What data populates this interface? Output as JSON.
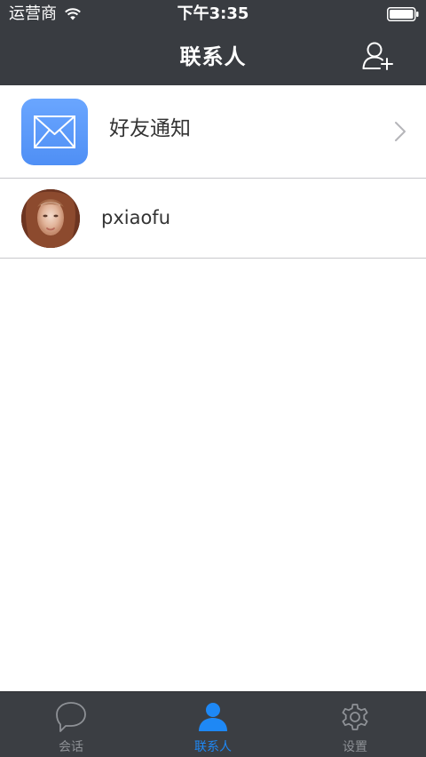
{
  "status_bar": {
    "carrier": "运营商",
    "time": "下午3:35"
  },
  "nav": {
    "title": "联系人"
  },
  "list": {
    "friend_notifications_label": "好友通知",
    "contacts": [
      {
        "name": "pxiaofu"
      }
    ]
  },
  "tabs": [
    {
      "label": "会话",
      "icon": "chat-bubble-icon",
      "active": false
    },
    {
      "label": "联系人",
      "icon": "person-icon",
      "active": true
    },
    {
      "label": "设置",
      "icon": "gear-icon",
      "active": false
    }
  ],
  "colors": {
    "bar_background": "#393c41",
    "accent": "#1e88f5",
    "mail_tile": "#5e9cfa"
  }
}
